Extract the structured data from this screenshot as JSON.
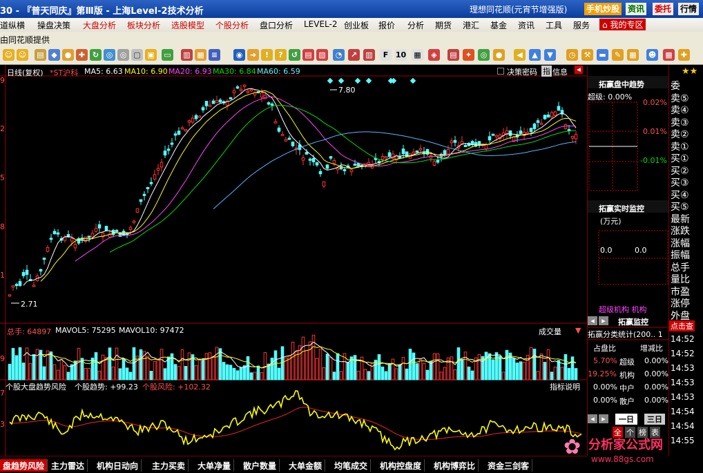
{
  "titlebar": {
    "title": "30 - 『普天同庆』第Ⅲ版 - 上海Level-2技术分析",
    "right_text": "理想同花顺(元宵节增强版)",
    "btn_mobile": "手机炒股",
    "btn_info": "资讯",
    "btn_delegate": "委托",
    "btn_market": "行情"
  },
  "menu": {
    "items": [
      "道纵横",
      "操盘决策",
      "大盘分析",
      "板块分析",
      "选股模型",
      "个股分析",
      "盘口分析",
      "LEVEL-2",
      "创业板",
      "报价",
      "分析",
      "期货",
      "港汇",
      "基金",
      "资讯",
      "工具",
      "服务",
      "我的专区"
    ]
  },
  "subbar": {
    "text": "由同花顺提供"
  },
  "chart": {
    "kline_header": {
      "period": "日线(复权)",
      "stock": "*ST沪科",
      "ma5": "MA5: 6.63",
      "ma10": "MA10: 6.90",
      "ma20": "MA20: 6.93",
      "ma30": "MA30: 6.84",
      "ma60": "MA60: 6.59"
    },
    "checkbox_label": "决策密码",
    "btn_zhi": "指",
    "btn_xinxi": "信息",
    "high_label": "7.80",
    "low_label": "2.71",
    "y_ticks_main": [
      "9",
      "2",
      "5",
      "8",
      "1",
      "4"
    ],
    "vol_header": {
      "total": "总手: 64897",
      "mavol5": "MAVOL5: 75295",
      "mavol10": "MAVOL10: 97472"
    },
    "vol_select": "成交量",
    "vol_ticks": [
      "9",
      "3"
    ],
    "ind_header": {
      "name": "个股大盘趋势风险",
      "trend": "个股趋势: +99.23",
      "risk": "个股风险: +102.32"
    },
    "ind_btn": "指标说明",
    "ind_ticks": [
      "7",
      "3"
    ]
  },
  "chart_data": {
    "type": "candlestick",
    "title": "日线(复权) *ST沪科",
    "price_high": 7.8,
    "price_low": 2.71,
    "ma": {
      "MA5": 6.63,
      "MA10": 6.9,
      "MA20": 6.93,
      "MA30": 6.84,
      "MA60": 6.59
    },
    "volume": {
      "total": 64897,
      "MAVOL5": 75295,
      "MAVOL10": 97472
    },
    "indicator": {
      "name": "个股大盘趋势风险",
      "trend": 99.23,
      "risk": 102.32
    }
  },
  "rightpanel": {
    "title1": "拓赢盘中趋势",
    "super": "超级: 0.00%",
    "pct_top": "0.02%",
    "pct_mid": "0.01%",
    "pct_bot": "-0.01%",
    "title2": "拓赢实时监控",
    "unit": "(万元)",
    "v1": "0.0",
    "v2": "0.0",
    "legend": "超级机构 机构",
    "tab": "拓赢监控",
    "stats_title": "拓赢分类统计(200.. 1",
    "col1": "占盘比",
    "col2": "增减比",
    "rows": [
      {
        "a": "5.70%",
        "n": "超级",
        "b": "0.00%"
      },
      {
        "a": "19.25%",
        "n": "机构",
        "b": "0.00%"
      },
      {
        "a": "0.00%",
        "n": "中户",
        "b": "0.00%"
      },
      {
        "a": "0.00%",
        "n": "散户",
        "b": "0.00%"
      }
    ],
    "day1": "一日",
    "day3": "三日",
    "mini_tabs": [
      "全",
      "个",
      "榜",
      "表"
    ]
  },
  "farright": {
    "labels": [
      "委",
      "卖⑤",
      "卖④",
      "卖③",
      "卖②",
      "卖①",
      "买①",
      "买②",
      "买③",
      "买④",
      "买⑤",
      "最新",
      "涨跌",
      "涨幅",
      "振幅",
      "总手",
      "量比",
      "市盈",
      "涨停",
      "外盘"
    ],
    "btn": "点击查",
    "times": [
      "14:52",
      "14:52",
      "14:53",
      "14:53",
      "14:53",
      "14:54",
      "14:54",
      "14:55"
    ]
  },
  "bottomtabs": [
    "盘趋势风险",
    "主力雷达",
    "机构日动向",
    "主力买卖",
    "大单净量",
    "散户数量",
    "大单金额",
    "均笔成交",
    "机构控盘度",
    "机构博弈比",
    "资金三剑客"
  ],
  "watermark": {
    "text": "分析家公式网",
    "url": "www.88gs.com"
  }
}
